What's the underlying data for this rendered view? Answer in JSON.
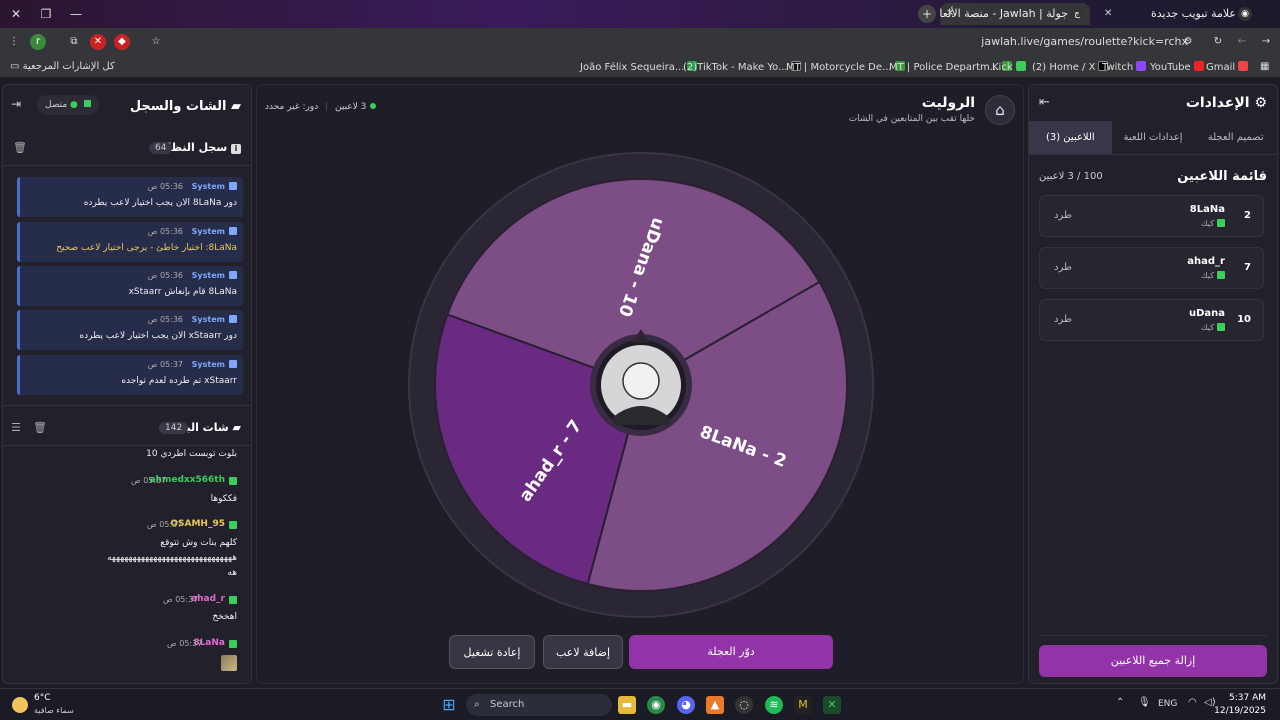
{
  "browser": {
    "tabs": [
      {
        "title": "جولة | Jawlah - منصة الألعاب الت",
        "active": true
      },
      {
        "title": "علامة تبويب جديدة",
        "active": false
      }
    ],
    "url": "jawlah.live/games/roulette?kick=rchx",
    "bookmarks_folder": "كل الإشارات المرجعية",
    "bookmarks": [
      "João Félix Sequeira...",
      "(2)TikTok - Make Yo...",
      "MT | Motorcycle De...",
      "MT | Police Departm...",
      "Kick",
      "(2) Home / X",
      "Twitch",
      "YouTube",
      "Gmail"
    ]
  },
  "settings": {
    "title": "الإعدادات",
    "tabs": [
      "اللاعبين (3)",
      "إعدادات اللعبة",
      "تصميم العجلة"
    ],
    "player_list_title": "قائمة اللاعبين",
    "player_count": "100 / 3 لاعبين",
    "players": [
      {
        "number": "2",
        "name": "8LaNa",
        "platform": "كيك",
        "kick_label": "طرد"
      },
      {
        "number": "7",
        "name": "ahad_r",
        "platform": "كيك",
        "kick_label": "طرد"
      },
      {
        "number": "10",
        "name": "uDana",
        "platform": "كيك",
        "kick_label": "طرد"
      }
    ],
    "remove_all": "إزالة جميع اللاعبين"
  },
  "game": {
    "title": "الروليت",
    "subtitle": "خلها تقب بين المتابعين في الشات",
    "players_status": "3 لاعبين",
    "turn_status": "دور: غير محدد",
    "wheel_segments": [
      "uDana - 10",
      "8LaNa - 2",
      "ahad_r - 7"
    ],
    "spin_button": "دوّر العجلة",
    "add_player_button": "إضافة لاعب",
    "restart_button": "إعادة تشغيل"
  },
  "chat_panel": {
    "title": "الشات والسجل",
    "connected": "متصل",
    "system_log_title": "سجل النظام",
    "system_log_count": "64",
    "logs": [
      {
        "who": "System",
        "time": "05:36 ص",
        "msg": "دور 8LaNa الان يجب اختيار لاعب يطرده",
        "warn": false
      },
      {
        "who": "System",
        "time": "05:36 ص",
        "msg": "8LaNa: اختيار خاطئ - يرجى اختيار لاعب صحيح",
        "warn": true
      },
      {
        "who": "System",
        "time": "05:36 ص",
        "msg": "8LaNa قام بإنعاش xStaarr",
        "warn": false
      },
      {
        "who": "System",
        "time": "05:36 ص",
        "msg": "دور xStaarr الان يجب اختيار لاعب يطرده",
        "warn": false
      },
      {
        "who": "System",
        "time": "05:37 ص",
        "msg": "xStaarr تم طرده لعدم تواجده",
        "warn": false
      }
    ],
    "stream_chat_title": "شات البث",
    "stream_chat_count": "142",
    "first_line": "بلوت توبست اطردي 10",
    "messages": [
      {
        "user": "ahmedxx566th",
        "time": "05:37 ص",
        "text": "فككوها",
        "color": "#3ccd5a"
      },
      {
        "user": "OSAMH_95",
        "time": "05:37 ص",
        "text": "كلهم بنات وش تتوقع",
        "text2": "ههههههههههههههههههههههههههههههه",
        "text3": "هه",
        "color": "#e8c85a"
      },
      {
        "user": "ahad_r",
        "time": "05:37 ص",
        "text": "اهخخخ",
        "color": "#e06bd0"
      },
      {
        "user": "8LaNa",
        "time": "05:37 ص",
        "text": "",
        "color": "#e06bd0"
      }
    ]
  },
  "taskbar": {
    "weather_temp": "6°C",
    "weather_desc": "سماء صافية",
    "search": "Search",
    "lang": "ENG",
    "time": "5:37 AM",
    "date": "12/19/2025"
  },
  "colors": {
    "accent": "#9333a8",
    "wheel_a": "#7d4e86",
    "wheel_b": "#6a2a82",
    "kick_green": "#3ccd5a"
  }
}
